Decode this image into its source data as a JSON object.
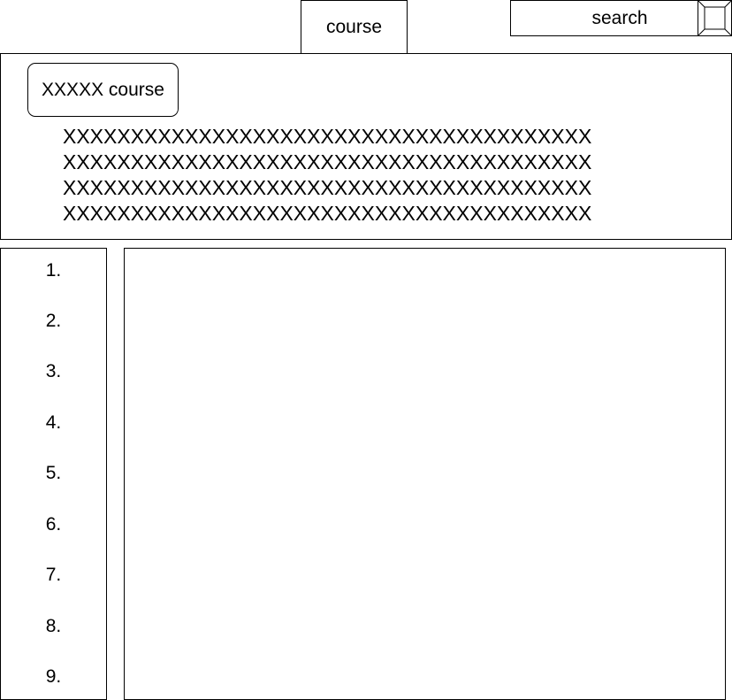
{
  "nav": {
    "course_tab": "course",
    "search_label": "search",
    "search_button_icon": "search-button-icon"
  },
  "course": {
    "name": "XXXXX course",
    "description_lines": [
      "XXXXXXXXXXXXXXXXXXXXXXXXXXXXXXXXXXXXXXX",
      "XXXXXXXXXXXXXXXXXXXXXXXXXXXXXXXXXXXXXXX",
      "XXXXXXXXXXXXXXXXXXXXXXXXXXXXXXXXXXXXXXX",
      "XXXXXXXXXXXXXXXXXXXXXXXXXXXXXXXXXXXXXXX"
    ]
  },
  "chapters": [
    "1.",
    "2.",
    "3.",
    "4.",
    "5.",
    "6.",
    "7.",
    "8.",
    "9."
  ],
  "colors": {
    "border": "#000000",
    "background": "#ffffff"
  }
}
